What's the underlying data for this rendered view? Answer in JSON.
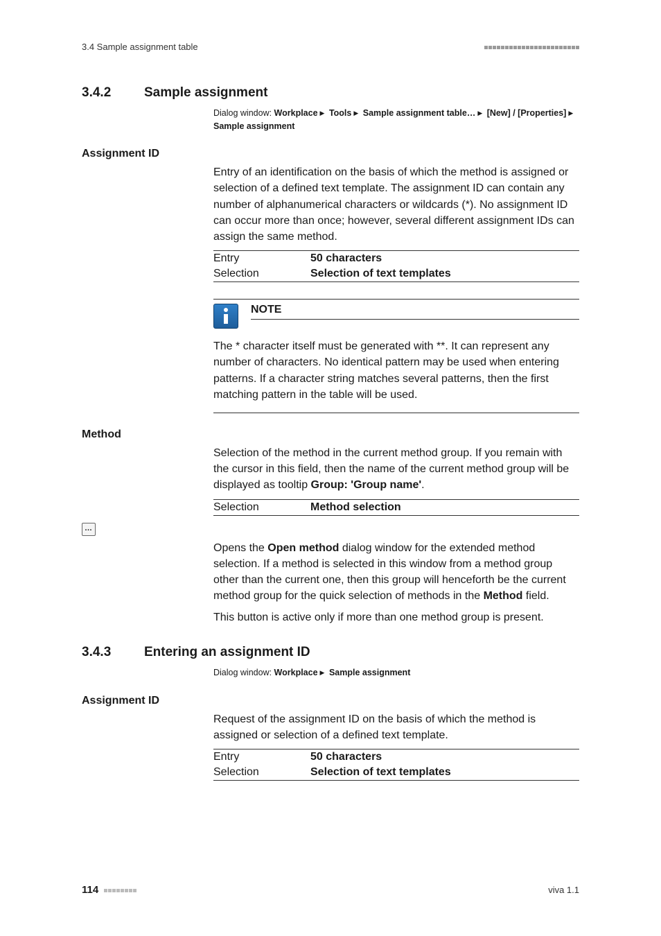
{
  "runhead": {
    "left": "3.4 Sample assignment table"
  },
  "sec342": {
    "num": "3.4.2",
    "title": "Sample assignment",
    "dlg_prefix": "Dialog window: ",
    "dlg_parts": [
      "Workplace",
      "Tools",
      "Sample assignment table…",
      "[New] / [Properties]",
      "Sample assignment"
    ]
  },
  "assignId1": {
    "heading": "Assignment ID",
    "para": "Entry of an identification on the basis of which the method is assigned or selection of a defined text template. The assignment ID can contain any number of alphanumerical characters or wildcards (*). No assignment ID can occur more than once; however, several different assignment IDs can assign the same method.",
    "rows": [
      {
        "k": "Entry",
        "v": "50 characters"
      },
      {
        "k": "Selection",
        "v": "Selection of text templates"
      }
    ]
  },
  "note": {
    "title": "NOTE",
    "body": "The * character itself must be generated with **. It can represent any number of characters. No identical pattern may be used when entering patterns. If a character string matches several patterns, then the first matching pattern in the table will be used."
  },
  "method": {
    "heading": "Method",
    "para_pre": "Selection of the method in the current method group. If you remain with the cursor in this field, then the name of the current method group will be displayed as tooltip ",
    "tooltip_bold": "Group: 'Group name'",
    "para_post": ".",
    "rows": [
      {
        "k": "Selection",
        "v": "Method selection"
      }
    ],
    "btn_para_pre": "Opens the ",
    "btn_bold1": "Open method",
    "btn_para_mid": " dialog window for the extended method selection. If a method is selected in this window from a method group other than the current one, then this group will henceforth be the current method group for the quick selection of methods in the ",
    "btn_bold2": "Method",
    "btn_para_post": " field.",
    "btn_para2": "This button is active only if more than one method group is present."
  },
  "sec343": {
    "num": "3.4.3",
    "title": "Entering an assignment ID",
    "dlg_prefix": "Dialog window: ",
    "dlg_parts": [
      "Workplace",
      "Sample assignment"
    ]
  },
  "assignId2": {
    "heading": "Assignment ID",
    "para": "Request of the assignment ID on the basis of which the method is assigned or selection of a defined text template.",
    "rows": [
      {
        "k": "Entry",
        "v": "50 characters"
      },
      {
        "k": "Selection",
        "v": "Selection of text templates"
      }
    ]
  },
  "footer": {
    "page": "114",
    "ver": "viva 1.1"
  }
}
